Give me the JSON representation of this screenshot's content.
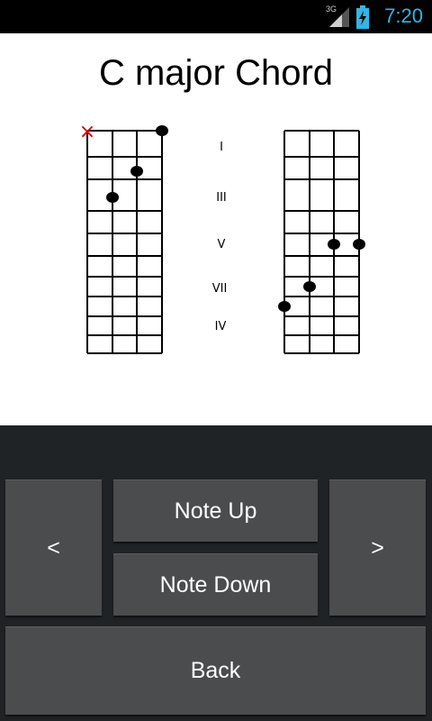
{
  "status_bar": {
    "time": "7:20",
    "network": "3G",
    "signal_icon": "signal-icon",
    "battery_icon": "battery-charging-icon",
    "accent": "#33b5e5"
  },
  "chord": {
    "title": "C major Chord"
  },
  "fret_markers": [
    "I",
    "III",
    "V",
    "VII",
    "IV"
  ],
  "diagram_left": {
    "muted_marker": "×",
    "muted_color": "#e00000"
  },
  "buttons": {
    "prev": "<",
    "note_up": "Note Up",
    "note_down": "Note Down",
    "next": ">",
    "back": "Back"
  }
}
